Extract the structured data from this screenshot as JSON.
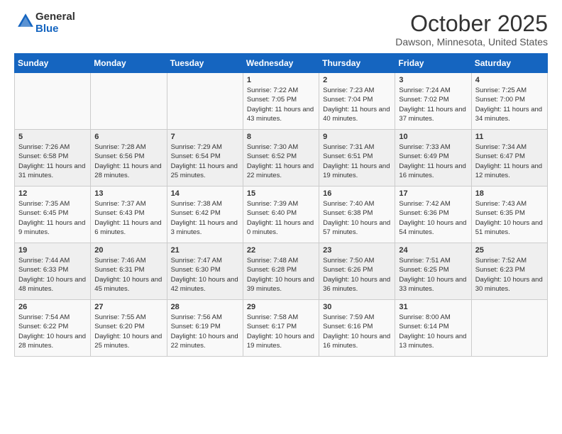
{
  "header": {
    "logo_general": "General",
    "logo_blue": "Blue",
    "title": "October 2025",
    "subtitle": "Dawson, Minnesota, United States"
  },
  "days_of_week": [
    "Sunday",
    "Monday",
    "Tuesday",
    "Wednesday",
    "Thursday",
    "Friday",
    "Saturday"
  ],
  "weeks": [
    [
      {
        "day": "",
        "info": ""
      },
      {
        "day": "",
        "info": ""
      },
      {
        "day": "",
        "info": ""
      },
      {
        "day": "1",
        "info": "Sunrise: 7:22 AM\nSunset: 7:05 PM\nDaylight: 11 hours and 43 minutes."
      },
      {
        "day": "2",
        "info": "Sunrise: 7:23 AM\nSunset: 7:04 PM\nDaylight: 11 hours and 40 minutes."
      },
      {
        "day": "3",
        "info": "Sunrise: 7:24 AM\nSunset: 7:02 PM\nDaylight: 11 hours and 37 minutes."
      },
      {
        "day": "4",
        "info": "Sunrise: 7:25 AM\nSunset: 7:00 PM\nDaylight: 11 hours and 34 minutes."
      }
    ],
    [
      {
        "day": "5",
        "info": "Sunrise: 7:26 AM\nSunset: 6:58 PM\nDaylight: 11 hours and 31 minutes."
      },
      {
        "day": "6",
        "info": "Sunrise: 7:28 AM\nSunset: 6:56 PM\nDaylight: 11 hours and 28 minutes."
      },
      {
        "day": "7",
        "info": "Sunrise: 7:29 AM\nSunset: 6:54 PM\nDaylight: 11 hours and 25 minutes."
      },
      {
        "day": "8",
        "info": "Sunrise: 7:30 AM\nSunset: 6:52 PM\nDaylight: 11 hours and 22 minutes."
      },
      {
        "day": "9",
        "info": "Sunrise: 7:31 AM\nSunset: 6:51 PM\nDaylight: 11 hours and 19 minutes."
      },
      {
        "day": "10",
        "info": "Sunrise: 7:33 AM\nSunset: 6:49 PM\nDaylight: 11 hours and 16 minutes."
      },
      {
        "day": "11",
        "info": "Sunrise: 7:34 AM\nSunset: 6:47 PM\nDaylight: 11 hours and 12 minutes."
      }
    ],
    [
      {
        "day": "12",
        "info": "Sunrise: 7:35 AM\nSunset: 6:45 PM\nDaylight: 11 hours and 9 minutes."
      },
      {
        "day": "13",
        "info": "Sunrise: 7:37 AM\nSunset: 6:43 PM\nDaylight: 11 hours and 6 minutes."
      },
      {
        "day": "14",
        "info": "Sunrise: 7:38 AM\nSunset: 6:42 PM\nDaylight: 11 hours and 3 minutes."
      },
      {
        "day": "15",
        "info": "Sunrise: 7:39 AM\nSunset: 6:40 PM\nDaylight: 11 hours and 0 minutes."
      },
      {
        "day": "16",
        "info": "Sunrise: 7:40 AM\nSunset: 6:38 PM\nDaylight: 10 hours and 57 minutes."
      },
      {
        "day": "17",
        "info": "Sunrise: 7:42 AM\nSunset: 6:36 PM\nDaylight: 10 hours and 54 minutes."
      },
      {
        "day": "18",
        "info": "Sunrise: 7:43 AM\nSunset: 6:35 PM\nDaylight: 10 hours and 51 minutes."
      }
    ],
    [
      {
        "day": "19",
        "info": "Sunrise: 7:44 AM\nSunset: 6:33 PM\nDaylight: 10 hours and 48 minutes."
      },
      {
        "day": "20",
        "info": "Sunrise: 7:46 AM\nSunset: 6:31 PM\nDaylight: 10 hours and 45 minutes."
      },
      {
        "day": "21",
        "info": "Sunrise: 7:47 AM\nSunset: 6:30 PM\nDaylight: 10 hours and 42 minutes."
      },
      {
        "day": "22",
        "info": "Sunrise: 7:48 AM\nSunset: 6:28 PM\nDaylight: 10 hours and 39 minutes."
      },
      {
        "day": "23",
        "info": "Sunrise: 7:50 AM\nSunset: 6:26 PM\nDaylight: 10 hours and 36 minutes."
      },
      {
        "day": "24",
        "info": "Sunrise: 7:51 AM\nSunset: 6:25 PM\nDaylight: 10 hours and 33 minutes."
      },
      {
        "day": "25",
        "info": "Sunrise: 7:52 AM\nSunset: 6:23 PM\nDaylight: 10 hours and 30 minutes."
      }
    ],
    [
      {
        "day": "26",
        "info": "Sunrise: 7:54 AM\nSunset: 6:22 PM\nDaylight: 10 hours and 28 minutes."
      },
      {
        "day": "27",
        "info": "Sunrise: 7:55 AM\nSunset: 6:20 PM\nDaylight: 10 hours and 25 minutes."
      },
      {
        "day": "28",
        "info": "Sunrise: 7:56 AM\nSunset: 6:19 PM\nDaylight: 10 hours and 22 minutes."
      },
      {
        "day": "29",
        "info": "Sunrise: 7:58 AM\nSunset: 6:17 PM\nDaylight: 10 hours and 19 minutes."
      },
      {
        "day": "30",
        "info": "Sunrise: 7:59 AM\nSunset: 6:16 PM\nDaylight: 10 hours and 16 minutes."
      },
      {
        "day": "31",
        "info": "Sunrise: 8:00 AM\nSunset: 6:14 PM\nDaylight: 10 hours and 13 minutes."
      },
      {
        "day": "",
        "info": ""
      }
    ]
  ]
}
